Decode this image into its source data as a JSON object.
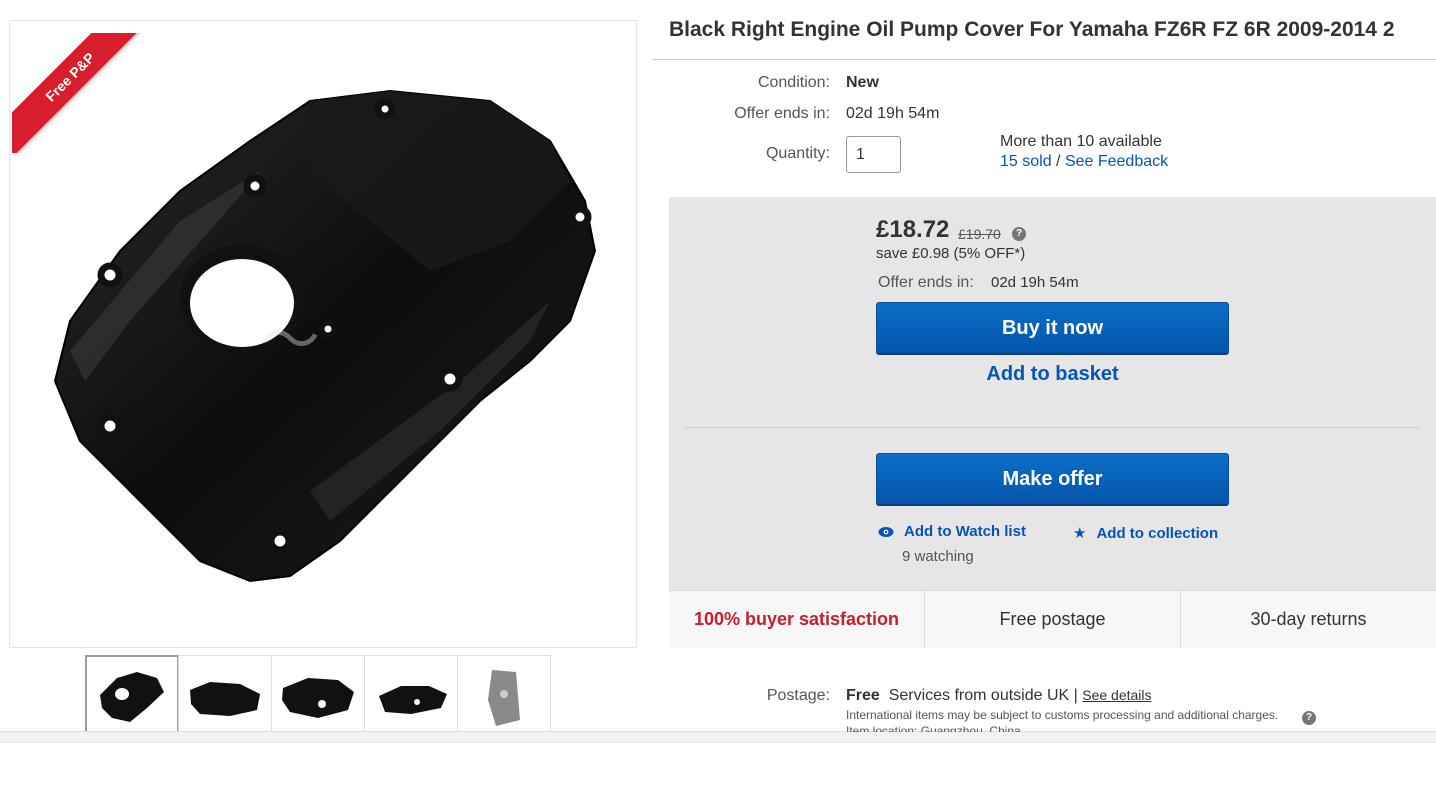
{
  "listing": {
    "title": "Black Right Engine Oil Pump Cover For Yamaha FZ6R FZ 6R 2009-2014 2",
    "ribbon": "Free P&P"
  },
  "details": {
    "condition_label": "Condition:",
    "condition_value": "New",
    "offer_ends_label": "Offer ends in:",
    "offer_ends_value": "02d 19h 54m",
    "quantity_label": "Quantity:",
    "quantity_value": "1",
    "availability": "More than 10 available",
    "sold_link": "15 sold",
    "sold_sep": " / ",
    "feedback_link": "See Feedback"
  },
  "buybox": {
    "price": "£18.72",
    "original_price": "£19.70",
    "help_glyph": "?",
    "save_text": "save £0.98 (5% OFF*)",
    "offer_ends_label": "Offer ends in:",
    "offer_ends_value": "02d 19h 54m",
    "buy_now": "Buy it now",
    "add_to_basket": "Add to basket",
    "make_offer": "Make offer",
    "add_watch": "Add to Watch list",
    "add_collection": "Add to collection",
    "watching": "9 watching"
  },
  "badges": {
    "satisfaction": "100% buyer satisfaction",
    "postage": "Free postage",
    "returns": "30-day returns"
  },
  "shipping": {
    "label": "Postage:",
    "free": "Free",
    "service": "Services from outside UK",
    "sep": " | ",
    "see_details": "See details",
    "note": "International items may be subject to customs processing and additional charges.",
    "location_partial": "Item location: Guangzhou, China"
  },
  "colors": {
    "accent_blue": "#0654ba",
    "ribbon_red": "#d81e2c",
    "satisfaction_red": "#c81e2b",
    "buybox_bg": "#e6e6e6"
  },
  "icons": {
    "watch": "eye-icon",
    "collection": "star-icon",
    "help": "help-icon"
  }
}
